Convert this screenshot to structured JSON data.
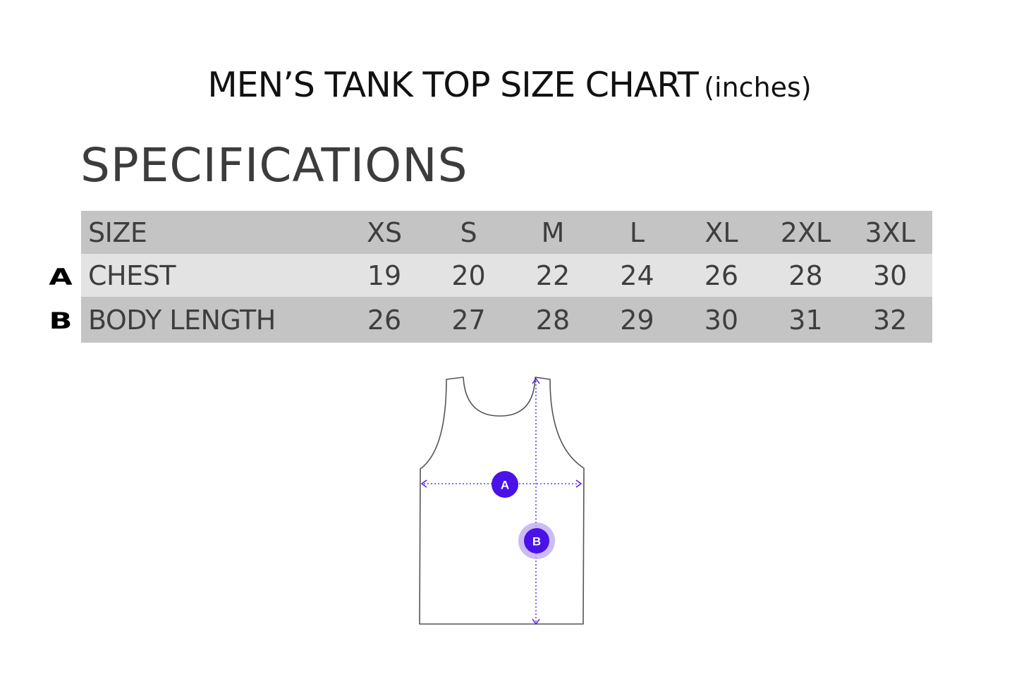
{
  "title": {
    "main": "MEN’S TANK TOP SIZE CHART",
    "unit": "(inches)"
  },
  "specifications_heading": "SPECIFICATIONS",
  "table": {
    "header": {
      "label": "SIZE",
      "sizes": [
        "XS",
        "S",
        "M",
        "L",
        "XL",
        "2XL",
        "3XL"
      ]
    },
    "rows": [
      {
        "marker": "A",
        "label": "CHEST",
        "values": [
          "19",
          "20",
          "22",
          "24",
          "26",
          "28",
          "30"
        ]
      },
      {
        "marker": "B",
        "label": "BODY LENGTH",
        "values": [
          "26",
          "27",
          "28",
          "29",
          "30",
          "31",
          "32"
        ]
      }
    ]
  },
  "diagram": {
    "marker_a": "A",
    "marker_b": "B",
    "marker_color": "#4a12e6"
  }
}
